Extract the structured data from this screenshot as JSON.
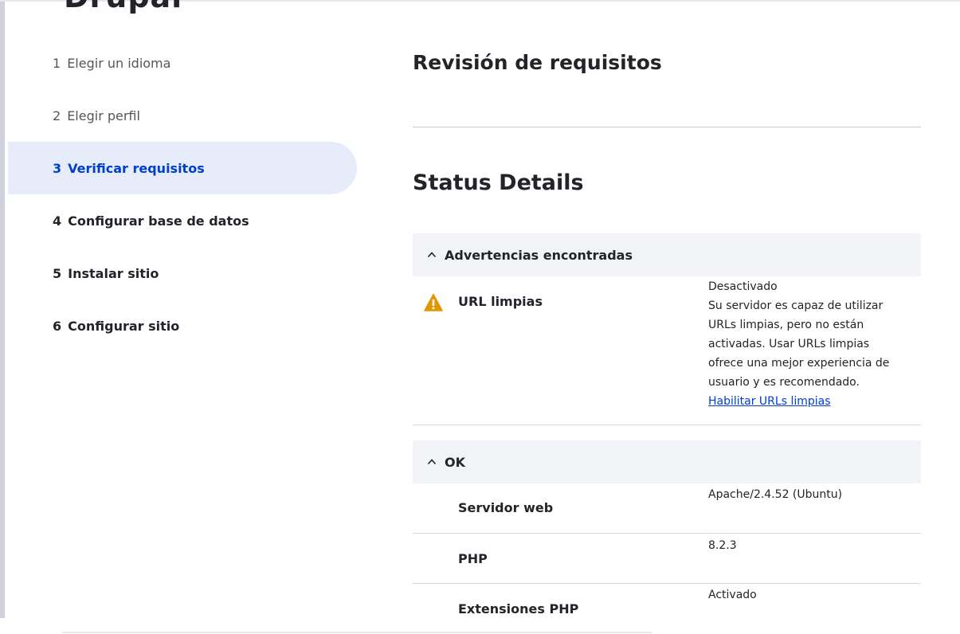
{
  "header": {
    "cut_title": "Drupal"
  },
  "steps": [
    {
      "num": "1",
      "label": "Elegir un idioma"
    },
    {
      "num": "2",
      "label": "Elegir perfil"
    },
    {
      "num": "3",
      "label": "Verificar requisitos"
    },
    {
      "num": "4",
      "label": "Configurar base de datos"
    },
    {
      "num": "5",
      "label": "Instalar sitio"
    },
    {
      "num": "6",
      "label": "Configurar sitio"
    }
  ],
  "main": {
    "title": "Revisión de requisitos",
    "status_title": "Status Details",
    "warnings": {
      "heading": "Advertencias encontradas",
      "items": [
        {
          "label": "URL limpias",
          "status": "Desactivado",
          "description_lines": [
            "Su servidor es capaz de utilizar",
            "URLs limpias, pero no están",
            "activadas. Usar URLs limpias",
            "ofrece una mejor experiencia de",
            "usuario y es recomendado."
          ],
          "link": "Habilitar URLs limpias"
        }
      ]
    },
    "ok": {
      "heading": "OK",
      "items": [
        {
          "label": "Servidor web",
          "value": "Apache/2.4.52 (Ubuntu)"
        },
        {
          "label": "PHP",
          "value": "8.2.3"
        },
        {
          "label": "Extensiones PHP",
          "value": "Activado"
        }
      ]
    }
  },
  "colors": {
    "accent": "#003ecc",
    "active_bg": "#e6ecfa",
    "warning": "#e29700"
  },
  "icons": {
    "warning": "warning-triangle-icon",
    "collapse": "chevron-up-icon"
  }
}
